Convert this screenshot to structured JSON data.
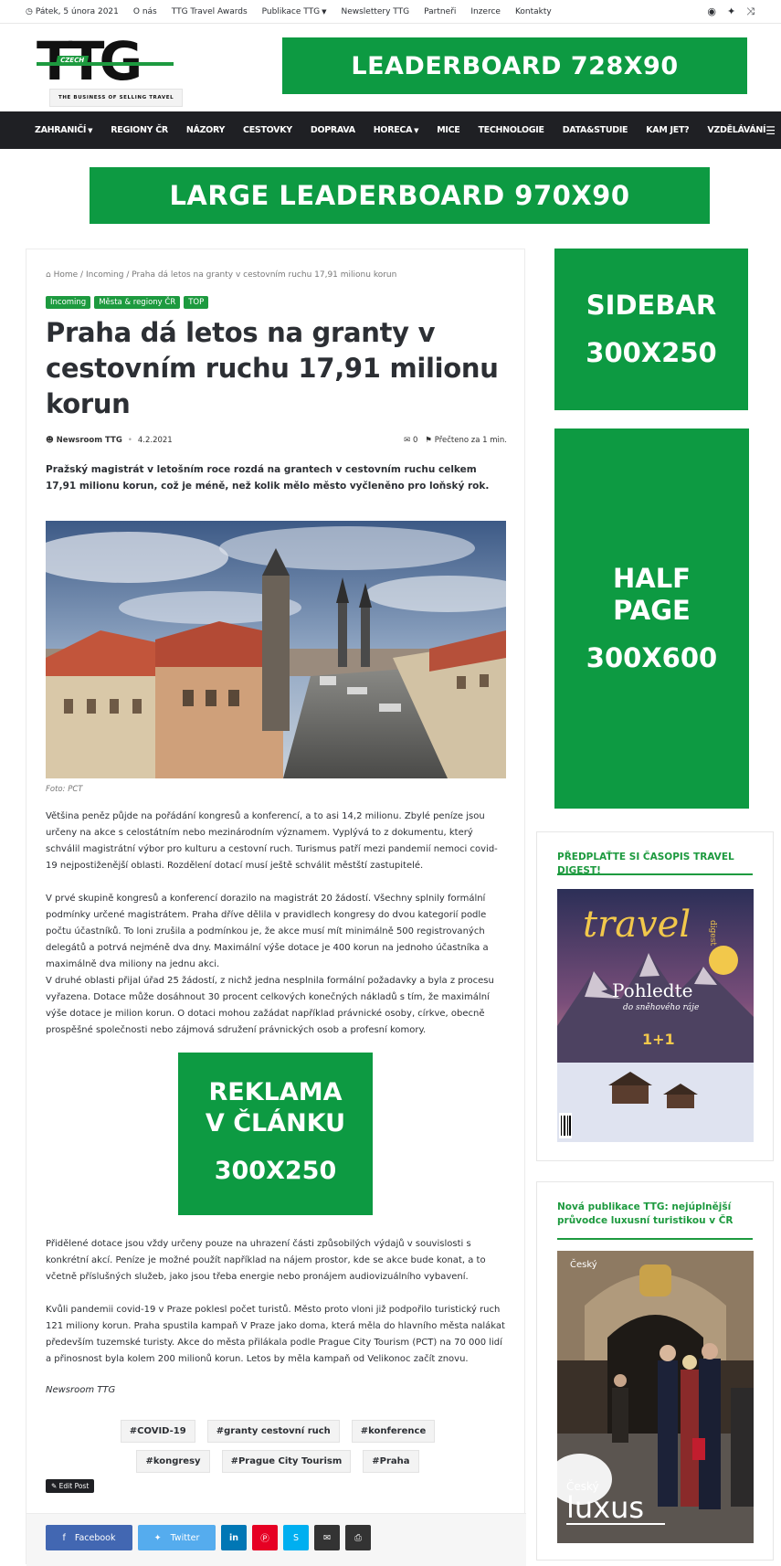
{
  "topbar": {
    "date": "Pátek, 5 února 2021",
    "links": [
      "O nás",
      "TTG Travel Awards",
      "Publikace TTG",
      "Newslettery TTG",
      "Partneři",
      "Inzerce",
      "Kontakty"
    ]
  },
  "logo": {
    "text": "TTG",
    "badge": "CZECH",
    "tagline": "THE BUSINESS OF SELLING TRAVEL"
  },
  "ads": {
    "leaderboard": "LEADERBOARD 728X90",
    "large_leaderboard": "LARGE LEADERBOARD 970X90",
    "sidebar_1": "SIDEBAR",
    "sidebar_2": "300X250",
    "half_1": "HALF",
    "half_2": "PAGE",
    "half_3": "300X600",
    "inarticle_1": "REKLAMA",
    "inarticle_2": "V ČLÁNKU",
    "inarticle_3": "300X250"
  },
  "nav": {
    "items": [
      "ZAHRANIČÍ",
      "REGIONY ČR",
      "NÁZORY",
      "CESTOVKY",
      "DOPRAVA",
      "HORECA",
      "MICE",
      "TECHNOLOGIE",
      "DATA&STUDIE",
      "KAM JET?",
      "VZDĚLÁVÁNÍ"
    ]
  },
  "breadcrumb": {
    "home": "Home",
    "sep": "/",
    "section": "Incoming",
    "current": "Praha dá letos na granty v cestovním ruchu 17,91 milionu korun"
  },
  "categories": [
    "Incoming",
    "Města & regiony ČR",
    "TOP"
  ],
  "article": {
    "title": "Praha dá letos na granty v cestovním ruchu 17,91 milionu korun",
    "author": "Newsroom TTG",
    "date": "4.2.2021",
    "comments": "0",
    "read_time": "Přečteno za 1 min.",
    "lead": "Pražský magistrát v letošním roce rozdá na grantech v cestovním ruchu celkem 17,91 milionu korun, což je méně, než kolik mělo město vyčleněno pro loňský rok.",
    "photo_caption": "Foto: PCT",
    "paragraphs": [
      "Většina peněz půjde na pořádání kongresů a konferencí, a to asi 14,2 milionu. Zbylé peníze jsou určeny na akce s celostátním nebo mezinárodním významem. Vyplývá to z dokumentu, který schválil magistrátní výbor pro kulturu a cestovní ruch. Turismus patří mezi pandemií nemoci covid-19 nejpostiženější oblasti. Rozdělení dotací musí ještě schválit městští zastupitelé.",
      "V prvé skupině kongresů a konferencí dorazilo na magistrát 20 žádostí. Všechny splnily formální podmínky určené magistrátem. Praha dříve dělila v pravidlech kongresy do dvou kategorií podle počtu účastníků. To loni zrušila a podmínkou je, že akce musí mít minimálně 500 registrovaných delegátů a potrvá nejméně dva dny. Maximální výše dotace je 400 korun na jednoho účastníka a maximálně dva miliony na jednu akci.",
      "V druhé oblasti přijal úřad 25 žádostí, z nichž jedna nesplnila formální požadavky a byla z procesu vyřazena. Dotace může dosáhnout 30 procent celkových konečných nákladů s tím, že maximální výše dotace je milion korun. O dotaci mohou zažádat například právnické osoby, církve, obecně prospěšné společnosti nebo zájmová sdružení právnických osob a profesní komory.",
      "Přidělené dotace jsou vždy určeny pouze na uhrazení části způsobilých výdajů v souvislosti s konkrétní akcí. Peníze je možné použít například na nájem prostor, kde se akce bude konat, a to včetně příslušných služeb, jako jsou třeba energie nebo pronájem audiovizuálního vybavení.",
      "Kvůli pandemii covid-19 v Praze poklesl počet turistů. Město proto vloni již podpořilo turistický ruch 121 miliony korun. Praha spustila kampaň V Praze jako doma, která měla do hlavního města nalákat především tuzemské turisty. Akce do města přilákala podle Prague City Tourism (PCT) na 70 000 lidí a přinosnost byla kolem 200 milionů korun. Letos by měla kampaň od Velikonoc začít znovu."
    ],
    "signature": "Newsroom TTG",
    "tags": [
      "#COVID-19",
      "#granty cestovní ruch",
      "#konference",
      "#kongresy",
      "#Prague City Tourism",
      "#Praha"
    ],
    "edit_post": "Edit Post"
  },
  "share": {
    "facebook": "Facebook",
    "twitter": "Twitter"
  },
  "sidebar": {
    "widget1_title": "PŘEDPLAŤTE SI ČASOPIS TRAVEL DIGEST!",
    "cover1": {
      "brand": "travel",
      "brand_sub": "digest",
      "headline": "Pohledte",
      "subheadline": "do sněhového ráje",
      "number": "1+1"
    },
    "widget2_title": "Nová publikace TTG: nejúplnější průvodce luxusní turistikou v ČR",
    "cover2": {
      "brand_top": "Český",
      "brand": "luxus"
    }
  },
  "colors": {
    "green": "#0d9a42",
    "accent": "#1d9a3f",
    "nav_bg": "#1f2024",
    "facebook": "#4267b2",
    "twitter": "#55acee",
    "linkedin": "#0077b5",
    "pinterest": "#e60023",
    "skype": "#00aff0",
    "email": "#333333",
    "print": "#333333"
  }
}
